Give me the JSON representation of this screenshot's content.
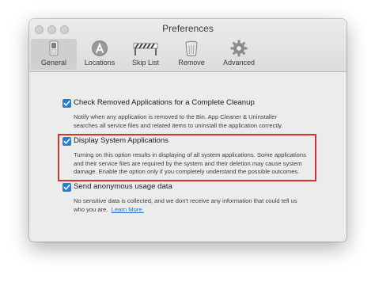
{
  "window": {
    "title": "Preferences"
  },
  "toolbar": {
    "tabs": [
      {
        "label": "General",
        "icon": "general-switch-icon",
        "active": true
      },
      {
        "label": "Locations",
        "icon": "app-store-icon",
        "active": false
      },
      {
        "label": "Skip List",
        "icon": "skip-list-icon",
        "active": false
      },
      {
        "label": "Remove",
        "icon": "trash-icon",
        "active": false
      },
      {
        "label": "Advanced",
        "icon": "gear-icon",
        "active": false
      }
    ]
  },
  "options": [
    {
      "label": "Check Removed Applications for a Complete Cleanup",
      "checked": true,
      "description": [
        "Notify when any application is removed to the Bin. App Cleaner & Uninstaller",
        "searches all service files and related items to uninstall the application correctly."
      ]
    },
    {
      "label": "Display System Applications",
      "checked": true,
      "description": [
        "Turning on this option results in displaying of all system applications. Some applications",
        "and their service files are required by the system and their deletion may cause system",
        "damage. Enable the option only if you completely understand the possible outcomes."
      ]
    },
    {
      "label": "Send anonymous usage data",
      "checked": true,
      "description": [
        "No sensitive data is collected, and we don't receive any information that could tell us",
        "who you are."
      ],
      "link": "Learn More."
    }
  ],
  "colors": {
    "accent": "#2a7bd8",
    "highlight": "#d8332d"
  }
}
